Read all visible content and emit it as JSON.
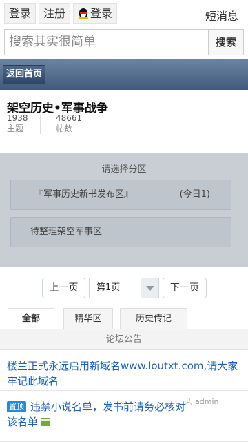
{
  "topbar": {
    "login_label": "登录",
    "register_label": "注册",
    "qq_login_label": "登录",
    "messages_label": "短消息"
  },
  "search": {
    "placeholder": "搜索其实很简单",
    "button_label": "搜索"
  },
  "nav": {
    "back_label": "返回首页"
  },
  "forum": {
    "title": "架空历史•军事战争",
    "stats": [
      {
        "value": "1938",
        "label": "主题"
      },
      {
        "value": "48661",
        "label": "帖数"
      }
    ]
  },
  "zones": {
    "heading": "请选择分区",
    "items": [
      {
        "name": "『军事历史新书发布区』",
        "today": "(今日1)"
      },
      {
        "name": "待整理架空军事区",
        "today": ""
      }
    ]
  },
  "pager": {
    "prev_label": "上一页",
    "current_page": "第1页",
    "next_label": "下一页"
  },
  "tabs": [
    {
      "label": "全部",
      "active": true
    },
    {
      "label": "精华区",
      "active": false
    },
    {
      "label": "历史传记",
      "active": false
    }
  ],
  "section": {
    "heading": "论坛公告"
  },
  "threads": [
    {
      "title": "楼兰正式永远启用新域名www.loutxt.com,请大家牢记此域名"
    },
    {
      "badge": "置顶",
      "title": "违禁小说名单，发书前请务必核对该名单",
      "author": "admin"
    }
  ],
  "colors": {
    "nav_bar": "#4a6285",
    "zone_bg": "#c9ced4",
    "link": "#1a5fb4",
    "pin_badge": "#2b88d8"
  }
}
